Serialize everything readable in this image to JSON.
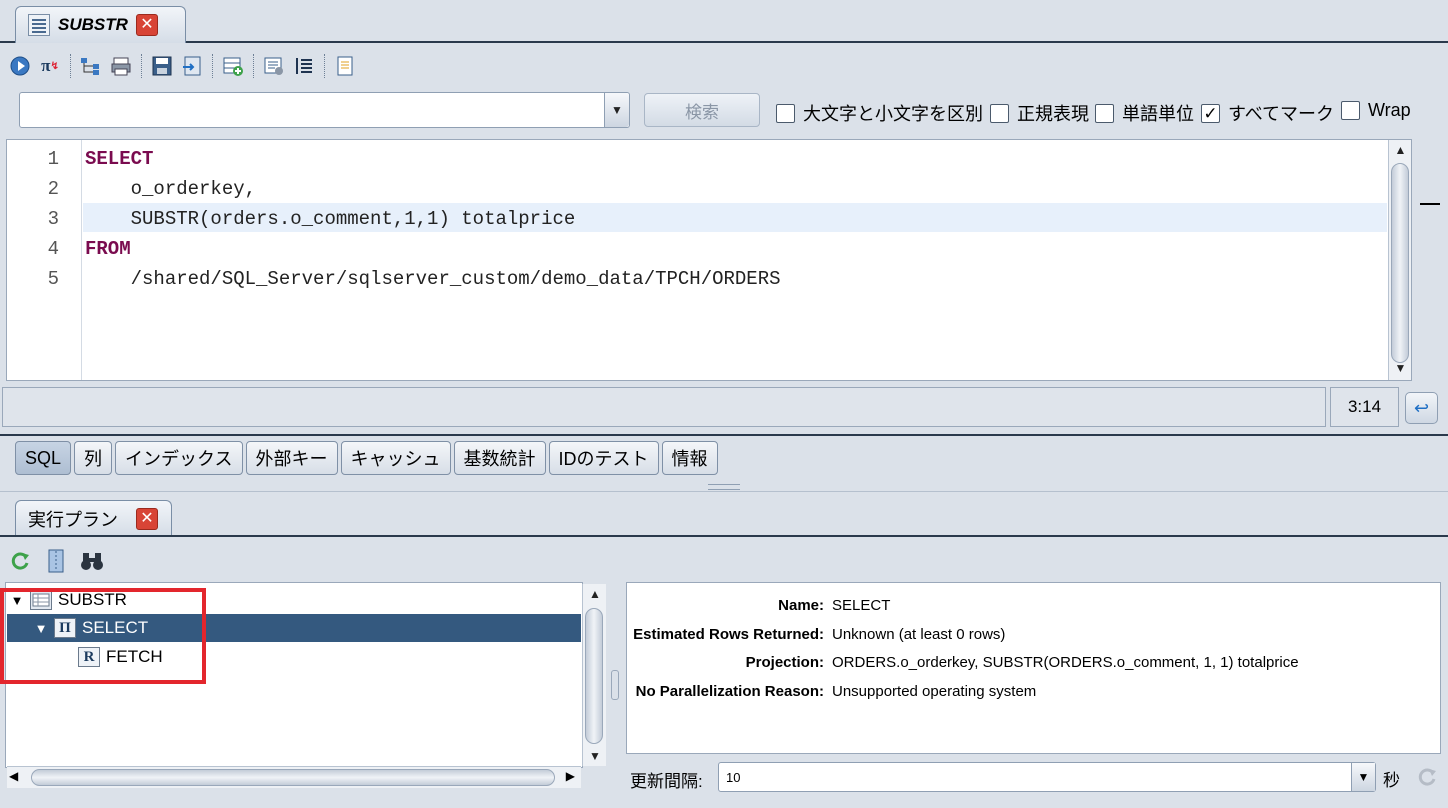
{
  "editor_tab": {
    "title": "SUBSTR"
  },
  "toolbar": {
    "icons": [
      "run-icon",
      "explain-icon",
      "plan-tree-icon",
      "print-icon",
      "save-icon",
      "export-icon",
      "new-row-icon",
      "format-icon",
      "indent-icon",
      "document-icon"
    ]
  },
  "search": {
    "value": "",
    "button_label": "検索",
    "options": [
      {
        "label": "大文字と小文字を区別",
        "checked": false
      },
      {
        "label": "正規表現",
        "checked": false
      },
      {
        "label": "単語単位",
        "checked": false
      },
      {
        "label": "すべてマーク",
        "checked": true
      },
      {
        "label": "Wrap",
        "checked": false
      }
    ]
  },
  "editor": {
    "lines": [
      {
        "num": "1",
        "text": "SELECT",
        "kw": true
      },
      {
        "num": "2",
        "text": "    o_orderkey,",
        "kw": false
      },
      {
        "num": "3",
        "text": "    SUBSTR(orders.o_comment,1,1) totalprice",
        "kw": false
      },
      {
        "num": "4",
        "text": "FROM",
        "kw": true
      },
      {
        "num": "5",
        "text": "    /shared/SQL_Server/sqlserver_custom/demo_data/TPCH/ORDERS",
        "kw": false
      }
    ],
    "highlight_line": 3,
    "cursor_position": "3:14"
  },
  "bottom_tabs": [
    "SQL",
    "列",
    "インデックス",
    "外部キー",
    "キャッシュ",
    "基数統計",
    "IDのテスト",
    "情報"
  ],
  "active_bottom_tab": "SQL",
  "plan_panel": {
    "tab_title": "実行プラン",
    "toolbar_icons": [
      "refresh-icon",
      "zip-icon",
      "binoculars-icon"
    ],
    "tree": [
      {
        "label": "SUBSTR",
        "level": 0,
        "icon": "table-icon",
        "expanded": true,
        "selected": false
      },
      {
        "label": "SELECT",
        "level": 1,
        "icon": "pi-icon",
        "icon_text": "Π",
        "expanded": true,
        "selected": true
      },
      {
        "label": "FETCH",
        "level": 2,
        "icon": "rx-icon",
        "icon_text": "R",
        "expanded": false,
        "selected": false
      }
    ],
    "properties": [
      {
        "key": "Name:",
        "value": "SELECT"
      },
      {
        "key": "Estimated Rows Returned:",
        "value": "Unknown (at least 0 rows)"
      },
      {
        "key": "Projection:",
        "value": "ORDERS.o_orderkey, SUBSTR(ORDERS.o_comment, 1, 1) totalprice"
      },
      {
        "key": "No Parallelization Reason:",
        "value": "Unsupported operating system"
      }
    ],
    "refresh_label": "更新間隔:",
    "refresh_value": "10",
    "refresh_unit": "秒"
  },
  "colors": {
    "keyword": "#7a0b4f",
    "selection": "#34597f",
    "annotation_box": "#e3262d"
  }
}
